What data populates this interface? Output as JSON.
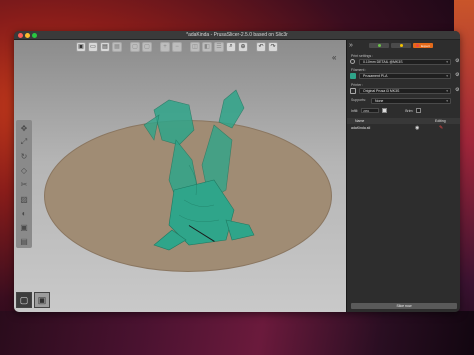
{
  "window": {
    "title": "*adaKinda - PrusaSlicer-2.5.0 based on Slic3r"
  },
  "toolbar": {
    "buttons": [
      {
        "name": "add-icon",
        "glyph": "▣"
      },
      {
        "name": "delete-icon",
        "glyph": "🗑"
      },
      {
        "name": "delete-all-icon",
        "glyph": "▤"
      },
      {
        "name": "arrange-icon",
        "glyph": "▦"
      },
      {
        "name": "copy-icon",
        "glyph": "▢"
      },
      {
        "name": "paste-icon",
        "glyph": "▢"
      },
      {
        "name": "add-instance-icon",
        "glyph": "⊕"
      },
      {
        "name": "remove-instance-icon",
        "glyph": "⊖"
      },
      {
        "name": "split-objects-icon",
        "glyph": "◫"
      },
      {
        "name": "split-parts-icon",
        "glyph": "◧"
      },
      {
        "name": "layers-icon",
        "glyph": "☰"
      },
      {
        "name": "search-icon",
        "glyph": "🔍"
      },
      {
        "name": "zoom-icon",
        "glyph": "⌕"
      },
      {
        "name": "undo-icon",
        "glyph": "↶"
      },
      {
        "name": "redo-icon",
        "glyph": "↷"
      }
    ]
  },
  "left_tools": [
    "move-icon",
    "scale-icon",
    "rotate-icon",
    "place-on-face-icon",
    "cut-icon",
    "paint-supports-icon",
    "seam-icon",
    "mmu-paint-icon",
    "variable-layer-icon"
  ],
  "panel": {
    "modes": [
      {
        "label": "",
        "color": "#6cc24a"
      },
      {
        "label": "",
        "color": "#f2c200"
      },
      {
        "label": "Expert",
        "color": "#e44"
      }
    ],
    "print_settings_label": "Print settings :",
    "print_profile": "0.10mm DETAIL @MK3S",
    "filament_label": "Filament :",
    "filament_profile": "Prusament PLA",
    "filament_color": "#2fa58a",
    "printer_label": "Printer :",
    "printer_profile": "Original Prusa i3 MK3S",
    "supports_label": "Supports:",
    "supports_value": "None",
    "infill_label": "Infill:",
    "infill_value": "20%",
    "brim_label": "Brim:",
    "list_name_header": "Name",
    "list_editing_header": "Editing",
    "object_name": "adaKinda.stl",
    "slice_button": "Slice now"
  }
}
